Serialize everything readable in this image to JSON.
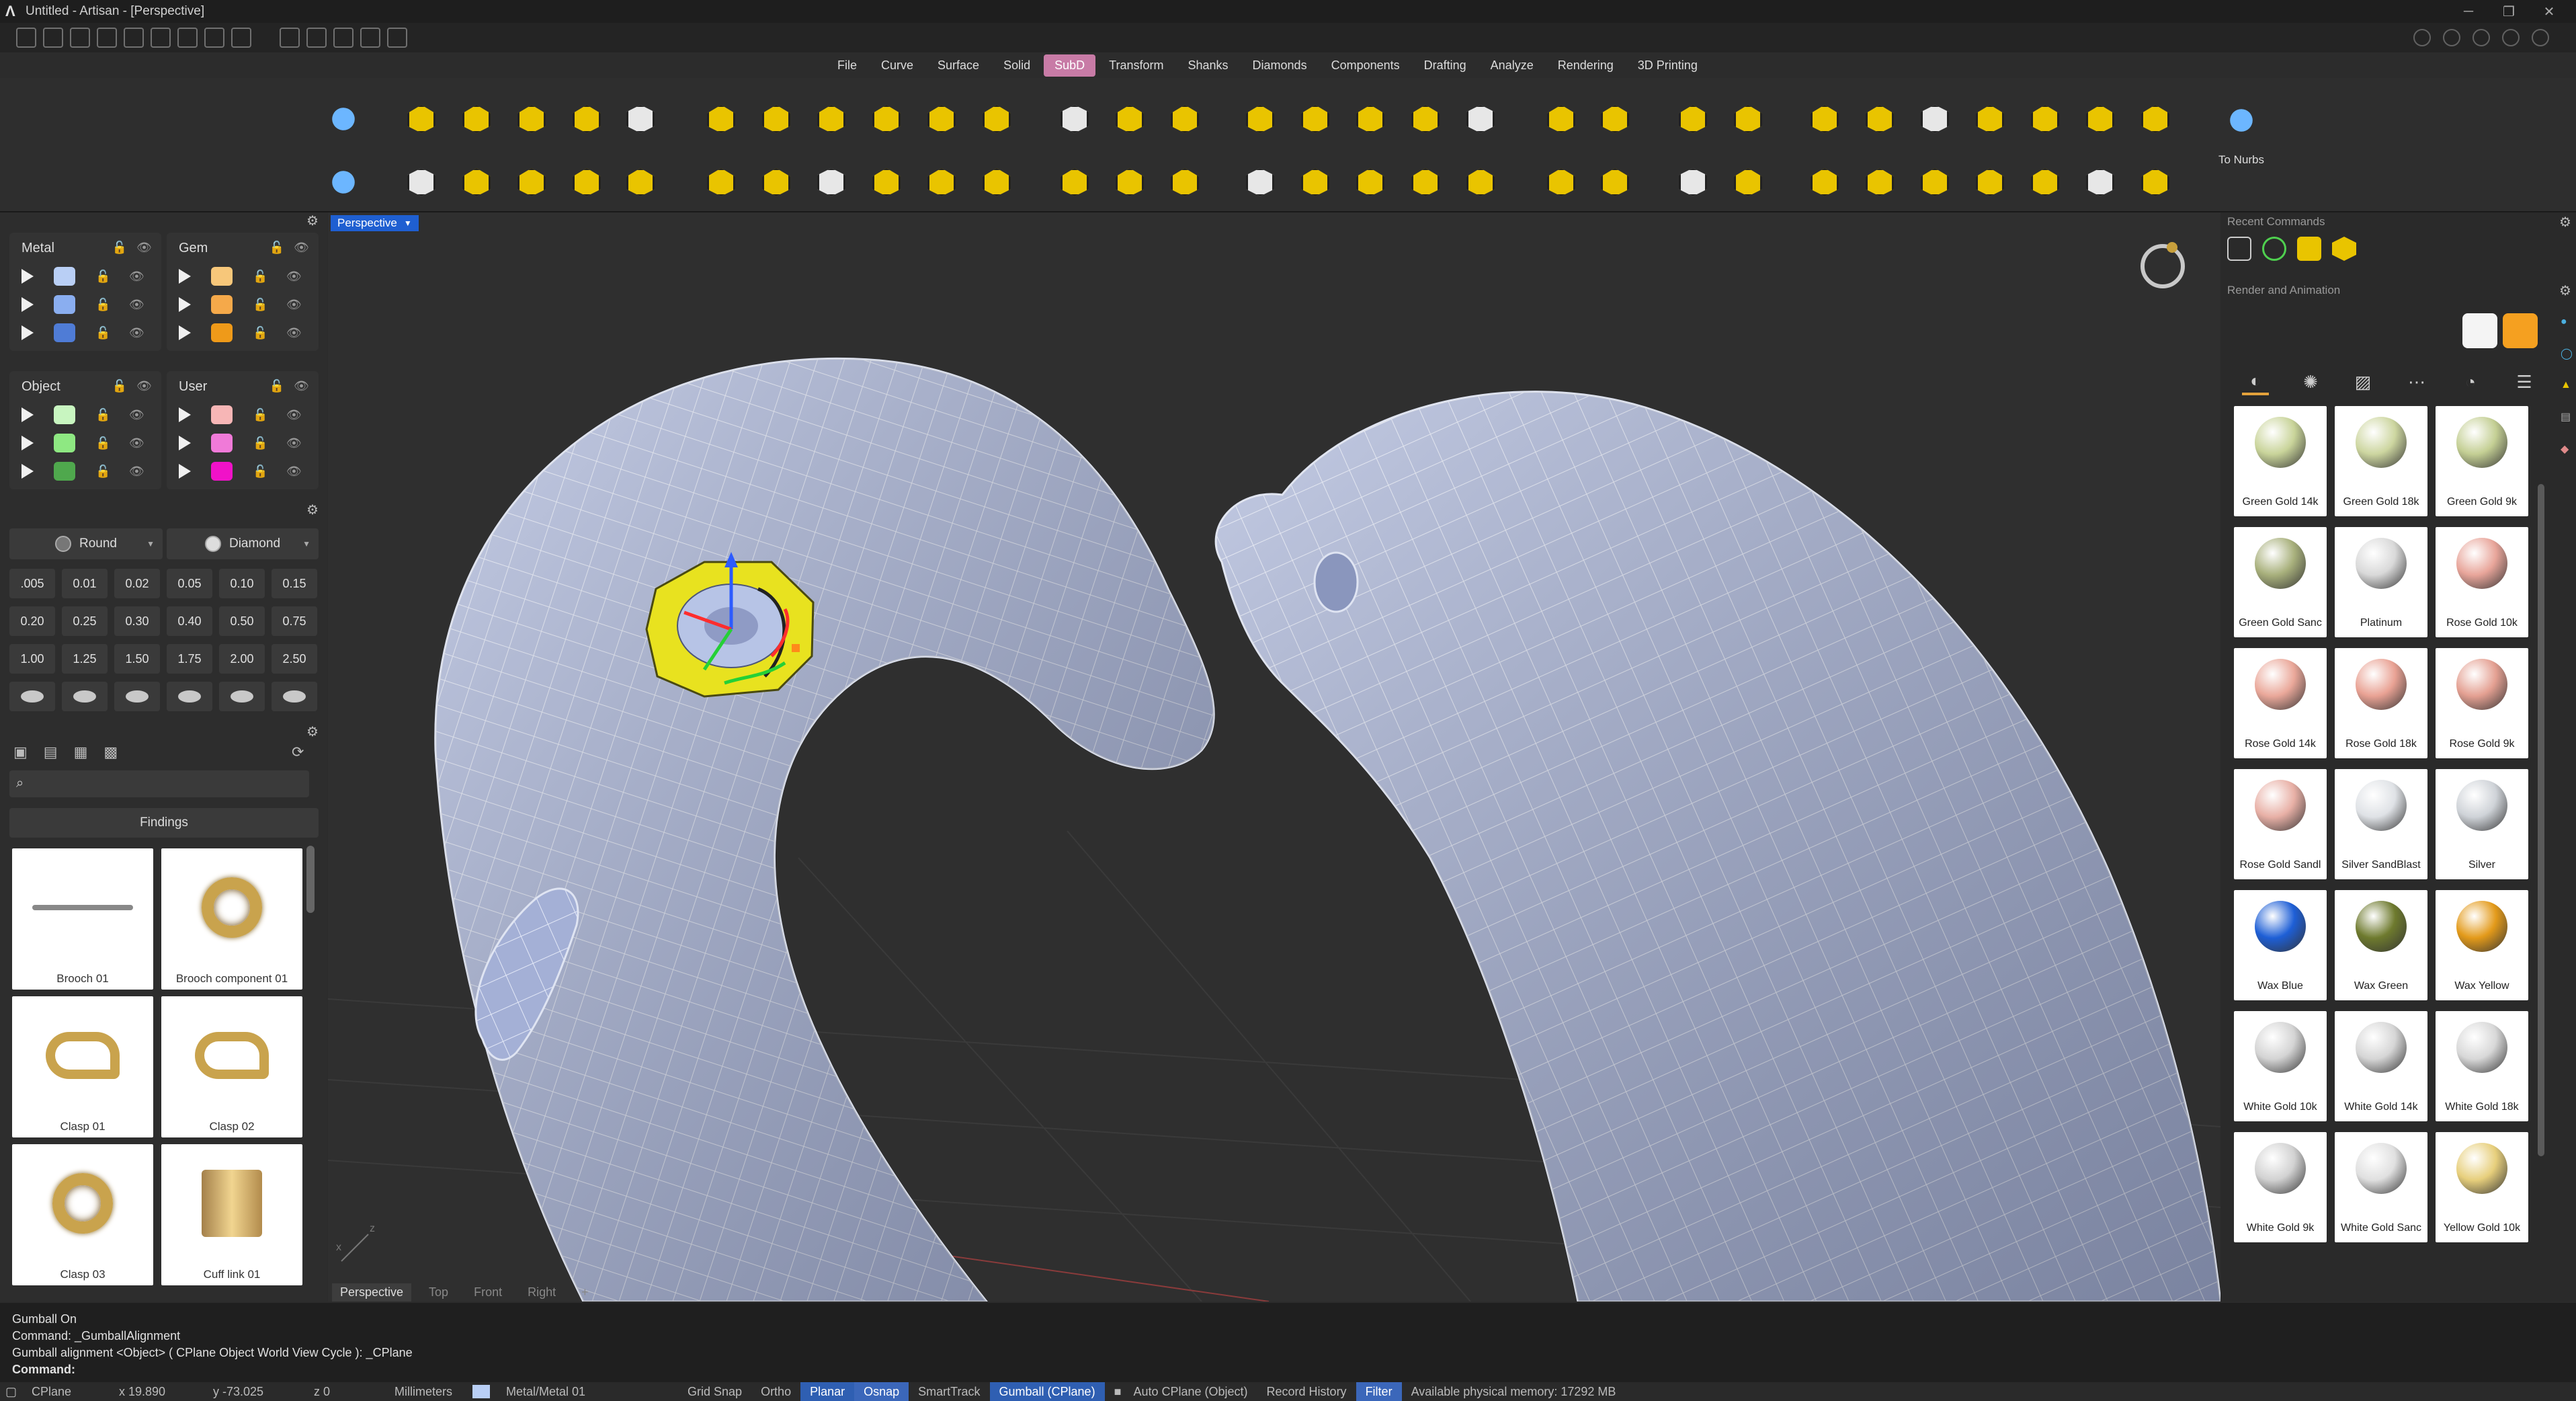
{
  "title": "Untitled - Artisan - [Perspective]",
  "menu": {
    "tabs": [
      "File",
      "Curve",
      "Surface",
      "Solid",
      "SubD",
      "Transform",
      "Shanks",
      "Diamonds",
      "Components",
      "Drafting",
      "Analyze",
      "Rendering",
      "3D Printing"
    ],
    "active": "SubD"
  },
  "ribbon": {
    "to_nurbs_label": "To Nurbs"
  },
  "layers": {
    "metal": {
      "title": "Metal",
      "colors": [
        "#b9cff5",
        "#8aaef0",
        "#4f7cd6"
      ]
    },
    "gem": {
      "title": "Gem",
      "colors": [
        "#f7c77a",
        "#f5a94a",
        "#ef9a19"
      ]
    },
    "object": {
      "title": "Object",
      "colors": [
        "#c8f5c0",
        "#8ee882",
        "#4fa84d"
      ]
    },
    "user": {
      "title": "User",
      "colors": [
        "#f7b6b6",
        "#f07ad8",
        "#f012c8"
      ]
    }
  },
  "gems": {
    "shape_round": "Round",
    "shape_diamond": "Diamond",
    "sizes": [
      ".005",
      "0.01",
      "0.02",
      "0.05",
      "0.10",
      "0.15",
      "0.20",
      "0.25",
      "0.30",
      "0.40",
      "0.50",
      "0.75",
      "1.00",
      "1.25",
      "1.50",
      "1.75",
      "2.00",
      "2.50"
    ]
  },
  "findings": {
    "header": "Findings",
    "search_placeholder": "",
    "items": [
      "Brooch 01",
      "Brooch component 01",
      "Clasp 01",
      "Clasp 02",
      "Clasp 03",
      "Cuff link 01"
    ]
  },
  "viewport": {
    "active_label": "Perspective",
    "tabs": [
      "Perspective",
      "Top",
      "Front",
      "Right"
    ],
    "add_tab": "+",
    "axis_x": "x",
    "axis_z": "z"
  },
  "right_panel": {
    "recent_commands_label": "Recent Commands",
    "render_label": "Render and Animation",
    "materials": [
      {
        "name": "Green Gold 14k",
        "color": "#c9d49a"
      },
      {
        "name": "Green Gold 18k",
        "color": "#cdd6a0"
      },
      {
        "name": "Green Gold 9k",
        "color": "#c4cf94"
      },
      {
        "name": "Green Gold Sanc",
        "color": "#a8b07c"
      },
      {
        "name": "Platinum",
        "color": "#d9d9d9"
      },
      {
        "name": "Rose Gold 10k",
        "color": "#e8a59a"
      },
      {
        "name": "Rose Gold 14k",
        "color": "#eaa89a"
      },
      {
        "name": "Rose Gold 18k",
        "color": "#e9a294"
      },
      {
        "name": "Rose Gold 9k",
        "color": "#e4a092"
      },
      {
        "name": "Rose Gold Sandl",
        "color": "#e8b0a6"
      },
      {
        "name": "Silver SandBlast",
        "color": "#dfe2e6"
      },
      {
        "name": "Silver",
        "color": "#cfd3d8"
      },
      {
        "name": "Wax Blue",
        "color": "#1e5fd6"
      },
      {
        "name": "Wax Green",
        "color": "#6e7a2e"
      },
      {
        "name": "Wax Yellow",
        "color": "#e39a1a"
      },
      {
        "name": "White Gold 10k",
        "color": "#d4d4d4"
      },
      {
        "name": "White Gold 14k",
        "color": "#d6d6d6"
      },
      {
        "name": "White Gold 18k",
        "color": "#d8d8d8"
      },
      {
        "name": "White Gold 9k",
        "color": "#d2d2d2"
      },
      {
        "name": "White Gold Sanc",
        "color": "#e0e0e0"
      },
      {
        "name": "Yellow Gold 10k",
        "color": "#e7cf7c"
      }
    ]
  },
  "command": {
    "history": [
      "Gumball On",
      "Command: _GumballAlignment",
      "Gumball alignment <Object> ( CPlane  Object  World  View  Cycle ): _CPlane"
    ],
    "prompt": "Command:"
  },
  "status": {
    "cplane": "CPlane",
    "x": "x 19.890",
    "y": "y -73.025",
    "z": "z 0",
    "units": "Millimeters",
    "layer": "Metal/Metal 01",
    "grid_snap": "Grid Snap",
    "ortho": "Ortho",
    "planar": "Planar",
    "osnap": "Osnap",
    "smarttrack": "SmartTrack",
    "gumball": "Gumball (CPlane)",
    "auto_cplane": "Auto CPlane (Object)",
    "record_history": "Record History",
    "filter": "Filter",
    "memory": "Available physical memory: 17292 MB"
  },
  "colors": {
    "accent": "#1f5fd1",
    "active_tab": "#c87ba6",
    "ribbon_icon": "#e9c400",
    "mesh": "#a9b6dd"
  }
}
